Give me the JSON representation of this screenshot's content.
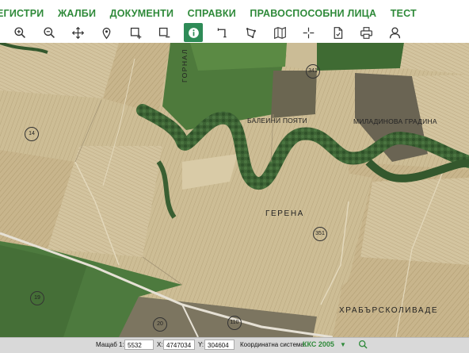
{
  "nav": {
    "items": [
      "ЕГИСТРИ",
      "ЖАЛБИ",
      "ДОКУМЕНТИ",
      "СПРАВКИ",
      "ПРАВОСПОСОБНИ ЛИЦА",
      "ТЕСТ"
    ]
  },
  "toolbar": {
    "tools": [
      {
        "icon": "zoom-in-icon"
      },
      {
        "icon": "zoom-out-icon"
      },
      {
        "icon": "pan-icon"
      },
      {
        "icon": "location-pin-icon"
      },
      {
        "icon": "select-area-icon"
      },
      {
        "icon": "deselect-area-icon"
      },
      {
        "icon": "info-icon",
        "active": true
      },
      {
        "icon": "measure-icon"
      },
      {
        "icon": "polygon-icon"
      },
      {
        "icon": "map-icon"
      },
      {
        "icon": "crosshair-icon"
      },
      {
        "icon": "document-icon"
      },
      {
        "icon": "print-icon"
      },
      {
        "icon": "user-icon"
      }
    ]
  },
  "map": {
    "place_labels": {
      "gornal": "ГОРНАЛ",
      "baleini": "БАЛЕИНИ ПОЯТИ",
      "miladinova": "МИЛАДИНОВА ГРАДИНА",
      "gerena": "ГЕРЕНА",
      "hrabar": "ХРАБЪРСКОЛИВАДЕ"
    },
    "parcels": {
      "p341": "341",
      "p14": "14",
      "p351": "351",
      "p19": "19",
      "p20": "20",
      "p110": "110"
    }
  },
  "status": {
    "scale_label": "Мащаб 1:",
    "scale_value": "5532",
    "x_label": "X:",
    "x_value": "4747034",
    "y_label": "Y:",
    "y_value": "304604",
    "crs_label": "Координатна система:",
    "crs_value": "ККС 2005"
  },
  "colors": {
    "brand_green": "#2f8a3a",
    "active_tool": "#2e8b57",
    "field": "#c9b88f",
    "vegetation": "#3e6a36"
  }
}
